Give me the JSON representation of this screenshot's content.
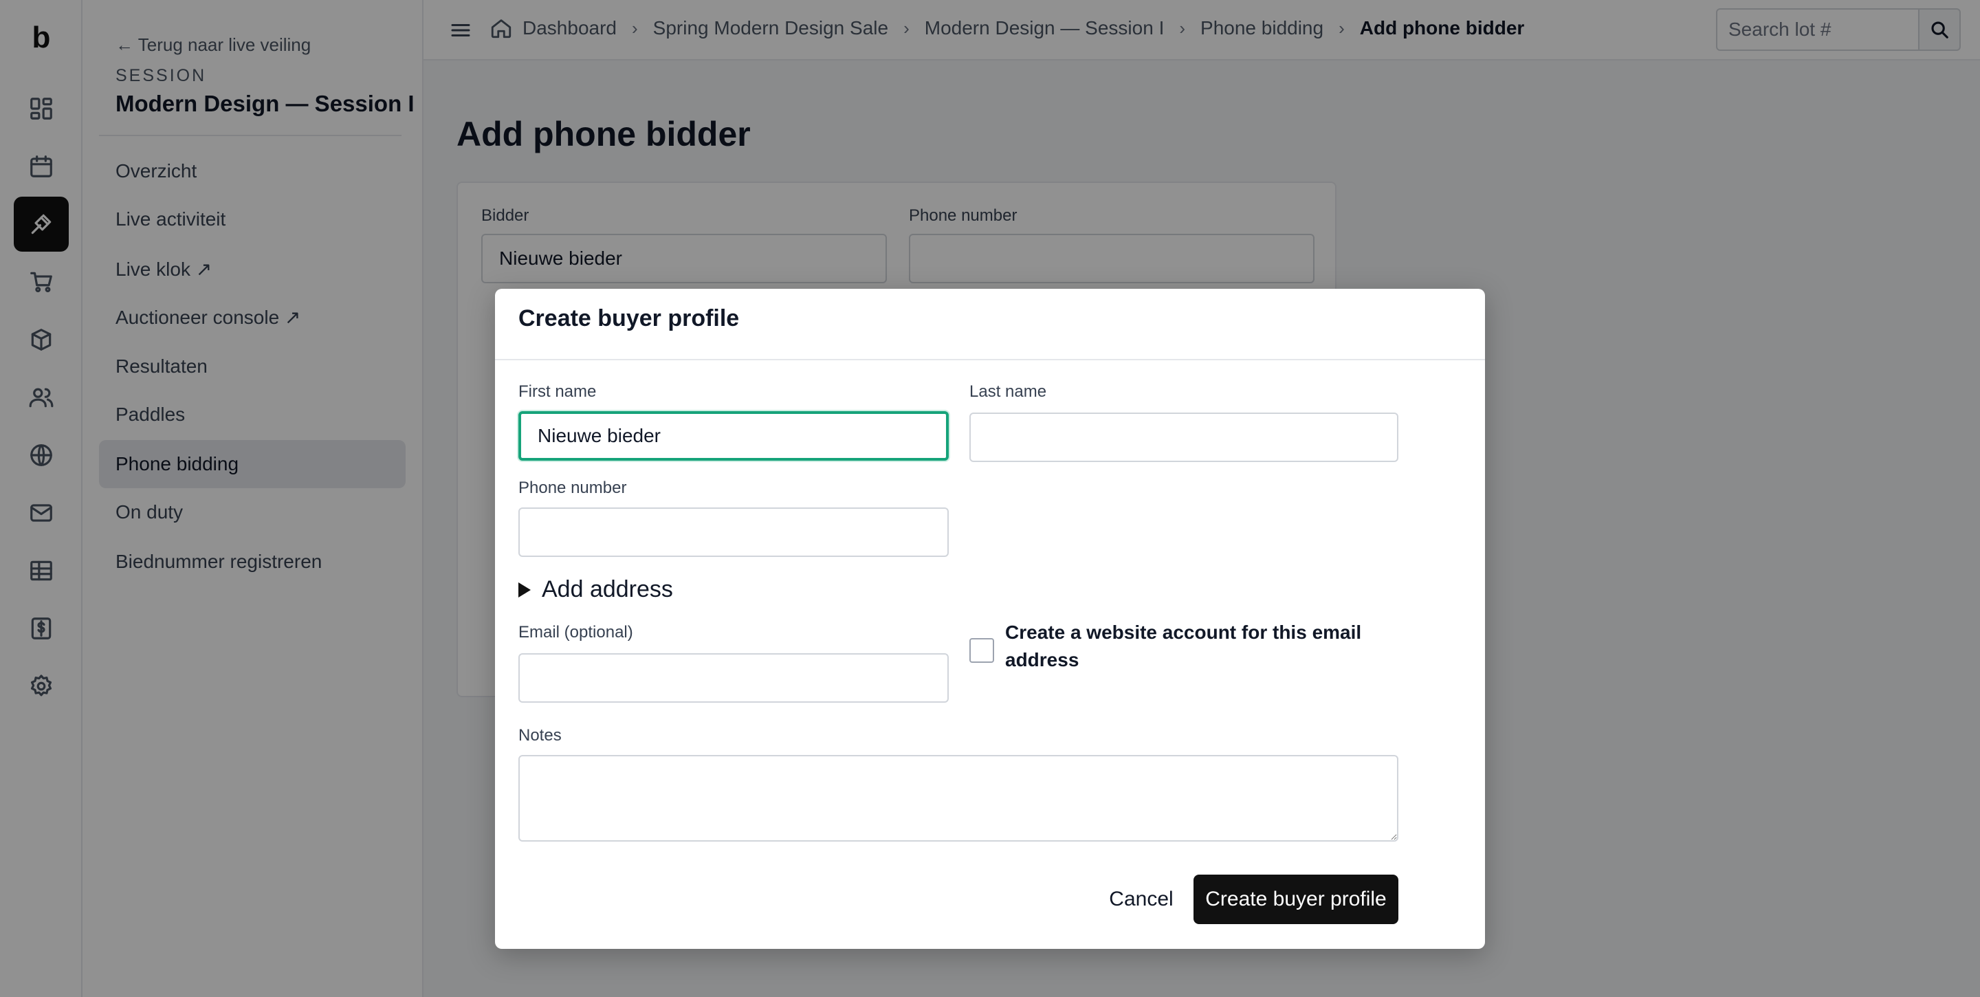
{
  "app": {
    "logo_letter": "b"
  },
  "rail": {
    "items": [
      {
        "icon": "dashboard-icon",
        "active": false
      },
      {
        "icon": "calendar-icon",
        "active": false
      },
      {
        "icon": "gavel-icon",
        "active": true
      },
      {
        "icon": "cart-icon",
        "active": false
      },
      {
        "icon": "box-icon",
        "active": false
      },
      {
        "icon": "users-icon",
        "active": false
      },
      {
        "icon": "globe-icon",
        "active": false
      },
      {
        "icon": "mail-icon",
        "active": false
      },
      {
        "icon": "table-icon",
        "active": false
      },
      {
        "icon": "invoice-icon",
        "active": false
      },
      {
        "icon": "gear-icon",
        "active": false
      }
    ]
  },
  "sidebar": {
    "back_link": "← Terug naar live veiling",
    "section_label": "SESSION",
    "session_name": "Modern Design — Session I",
    "items": [
      {
        "label": "Overzicht"
      },
      {
        "label": "Live activiteit"
      },
      {
        "label": "Live klok ↗"
      },
      {
        "label": "Auctioneer console ↗"
      },
      {
        "label": "Resultaten"
      },
      {
        "label": "Paddles"
      },
      {
        "label": "Phone bidding",
        "active": true
      },
      {
        "label": "On duty"
      },
      {
        "label": "Biednummer registreren"
      }
    ]
  },
  "topbar": {
    "breadcrumbs": [
      "Dashboard",
      "Spring Modern Design Sale",
      "Modern Design — Session I",
      "Phone bidding",
      "Add phone bidder"
    ],
    "search_placeholder": "Search lot #"
  },
  "page": {
    "title": "Add phone bidder",
    "form": {
      "bidder_label": "Bidder",
      "bidder_value": "Nieuwe bieder",
      "phone_label": "Phone number",
      "phone_value": ""
    }
  },
  "modal": {
    "title": "Create buyer profile",
    "first_name_label": "First name",
    "first_name_value": "Nieuwe bieder",
    "last_name_label": "Last name",
    "last_name_value": "",
    "phone_label": "Phone number",
    "phone_value": "",
    "add_address_label": "Add address",
    "email_label": "Email (optional)",
    "email_value": "",
    "website_account_label": "Create a website account for this email address",
    "website_account_checked": false,
    "notes_label": "Notes",
    "notes_value": "",
    "cancel_label": "Cancel",
    "submit_label": "Create buyer profile"
  }
}
